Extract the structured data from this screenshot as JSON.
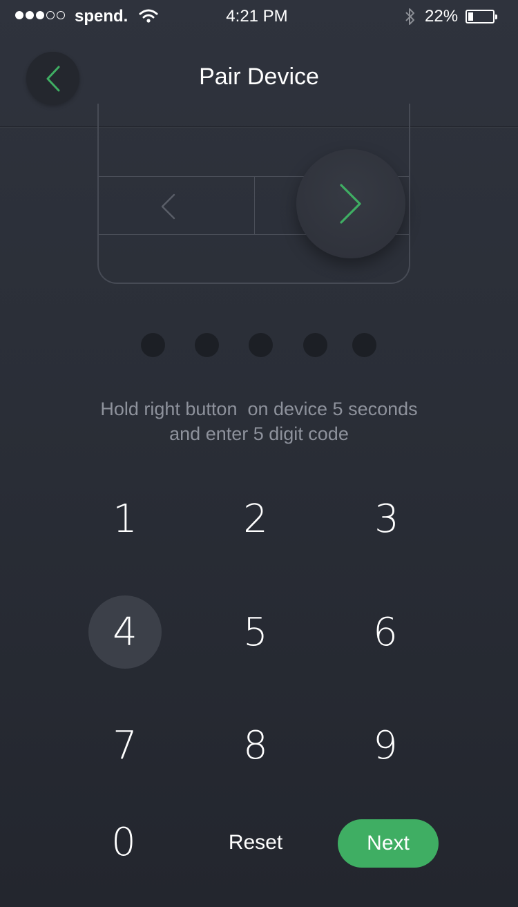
{
  "status_bar": {
    "carrier": "spend.",
    "time": "4:21 PM",
    "battery_percent": "22%",
    "battery_level": 0.22,
    "signal_bars": 3,
    "signal_total": 5,
    "icons": [
      "signal-icon",
      "wifi-icon",
      "bluetooth-icon",
      "battery-icon"
    ]
  },
  "nav": {
    "title": "Pair Device",
    "back_icon": "chevron-left-icon"
  },
  "colors": {
    "accent": "#3fae63",
    "background": "#2a2e37",
    "muted_text": "#8e929c"
  },
  "device": {
    "left_icon": "chevron-left-icon",
    "right_icon": "chevron-right-icon",
    "highlighted_button": "right"
  },
  "code": {
    "length": 5,
    "entered": 0
  },
  "instructions": {
    "line1": "Hold right button  on device 5 seconds",
    "line2": "and enter 5 digit code"
  },
  "keypad": {
    "keys": [
      "1",
      "2",
      "3",
      "4",
      "5",
      "6",
      "7",
      "8",
      "9",
      "0"
    ],
    "pressed_key": "4",
    "reset_label": "Reset",
    "next_label": "Next"
  }
}
